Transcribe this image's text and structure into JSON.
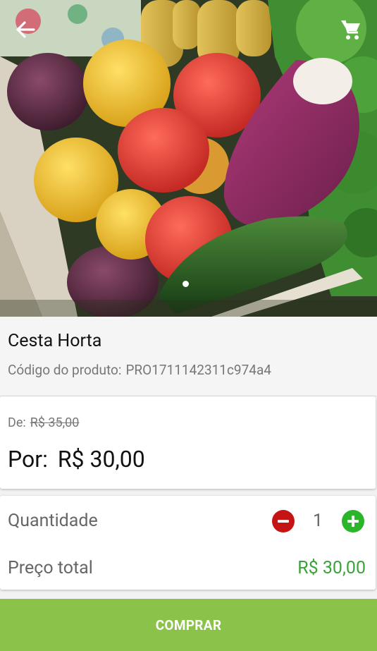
{
  "header": {
    "back_icon": "arrow-left-icon",
    "cart_icon": "shopping-cart-icon",
    "icon_color": "#ffffff"
  },
  "product": {
    "name": "Cesta Horta",
    "code_label": "Código do produto:",
    "code_value": "PRO1711142311c974a4"
  },
  "pricing": {
    "old_label": "De:",
    "old_price": "R$ 35,00",
    "new_label": "Por:",
    "new_price": "R$ 30,00"
  },
  "quantity": {
    "label": "Quantidade",
    "value": "1",
    "minus_icon": "minus-circle-icon",
    "plus_icon": "plus-circle-icon",
    "minus_color": "#c41414",
    "plus_color": "#2bb52b"
  },
  "total": {
    "label": "Preço total",
    "value": "R$ 30,00",
    "value_color": "#3aa339"
  },
  "buy_button": {
    "label": "COMPRAR",
    "color": "#8bc34a"
  }
}
